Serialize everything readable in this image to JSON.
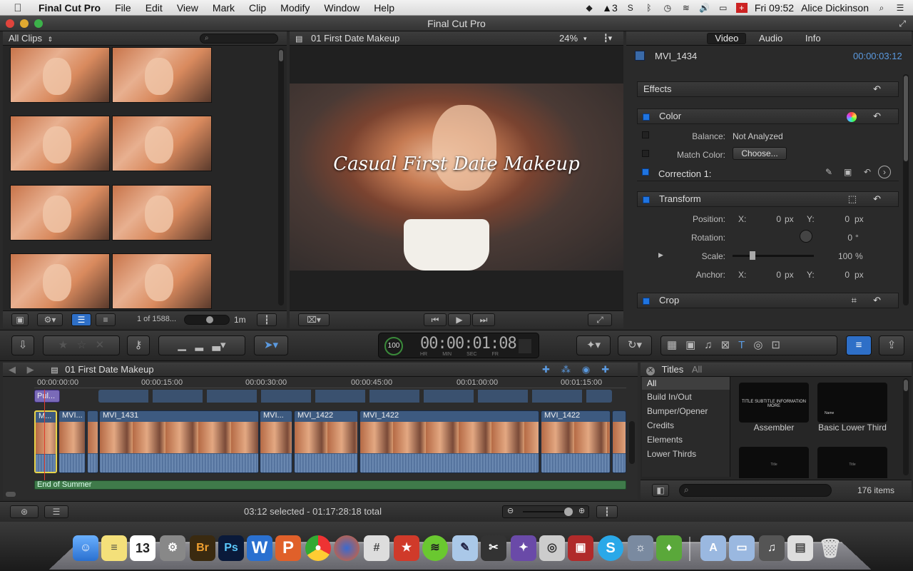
{
  "menubar": {
    "app": "Final Cut Pro",
    "items": [
      "File",
      "Edit",
      "View",
      "Mark",
      "Clip",
      "Modify",
      "Window",
      "Help"
    ],
    "status_badge": "3",
    "clock": "Fri 09:52",
    "user": "Alice Dickinson"
  },
  "window": {
    "title": "Final Cut Pro"
  },
  "browser": {
    "filter": "All Clips",
    "count": "1 of 1588...",
    "duration": "1m"
  },
  "viewer": {
    "title": "01 First Date Makeup",
    "zoom": "24%",
    "overlay_title": "Casual First Date Makeup"
  },
  "inspector": {
    "tabs": [
      "Video",
      "Audio",
      "Info"
    ],
    "clip_name": "MVI_1434",
    "timecode": "00:00:03:12",
    "effects": "Effects",
    "color": "Color",
    "balance_label": "Balance:",
    "balance_value": "Not Analyzed",
    "match_label": "Match Color:",
    "match_button": "Choose...",
    "correction": "Correction 1:",
    "transform": "Transform",
    "position_label": "Position:",
    "x_label": "X:",
    "y_label": "Y:",
    "pos_x": "0",
    "pos_y": "0",
    "unit_px": "px",
    "rotation_label": "Rotation:",
    "rotation_value": "0",
    "unit_deg": "°",
    "scale_label": "Scale:",
    "scale_value": "100",
    "unit_pct": "%",
    "anchor_label": "Anchor:",
    "anc_x": "0",
    "anc_y": "0",
    "crop": "Crop"
  },
  "toolbar": {
    "timecode_display": "00:00:01:08",
    "tc_hr": "HR",
    "tc_min": "MIN",
    "tc_sec": "SEC",
    "tc_fr": "FR",
    "pct": "100"
  },
  "timeline": {
    "project": "01 First Date Makeup",
    "ruler": [
      "00:00:00:00",
      "00:00:15:00",
      "00:00:30:00",
      "00:00:45:00",
      "00:01:00:00",
      "00:01:15:00"
    ],
    "title_clip": "Pul...",
    "clips": [
      {
        "name": "M..."
      },
      {
        "name": "MVI..."
      },
      {
        "name": "MVI_1431"
      },
      {
        "name": "MVI..."
      },
      {
        "name": "MVI_1422"
      },
      {
        "name": "MVI_1422"
      },
      {
        "name": "MVI_1422"
      }
    ],
    "music": "End of Summer",
    "status": "03:12 selected - 01:17:28:18 total"
  },
  "titles": {
    "header": "Titles",
    "header_all": "All",
    "categories": [
      "All",
      "Build In/Out",
      "Bumper/Opener",
      "Credits",
      "Elements",
      "Lower Thirds"
    ],
    "items": [
      {
        "name": "Assembler",
        "preview": "TITLE SUBTITLE INFORMATION MORE"
      },
      {
        "name": "Basic Lower Third",
        "preview": "Name"
      },
      {
        "name": "",
        "preview": "Title"
      },
      {
        "name": "",
        "preview": "Title"
      }
    ],
    "count": "176 items"
  },
  "dock": {
    "calendar_day": "13",
    "br": "Br",
    "ps": "Ps"
  }
}
